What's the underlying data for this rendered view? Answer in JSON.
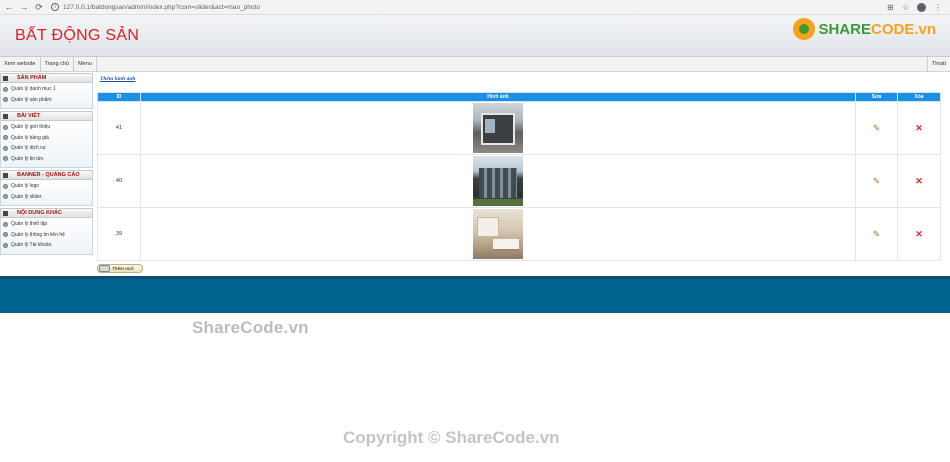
{
  "browser": {
    "url": "127.0.0.1/batdongsan/admin/index.php?com=slider&act=man_photo"
  },
  "header": {
    "site_title": "BẤT ĐỘNG SẢN",
    "logo_text_a": "SHARE",
    "logo_text_b": "CODE.vn"
  },
  "menu": {
    "items": [
      "Xem website",
      "Trang chủ",
      "Menu"
    ],
    "logout": "Thoát"
  },
  "sidebar": {
    "sections": [
      {
        "title": "SẢN PHẨM",
        "links": [
          "Quản lý danh mục 1",
          "Quản lý sản phẩm"
        ]
      },
      {
        "title": "BÀI VIẾT",
        "links": [
          "Quản lý giới thiệu",
          "Quản lý bảng giá",
          "Quản lý dịch vụ",
          "Quản lý tin tức"
        ]
      },
      {
        "title": "BANNER - QUẢNG CÁO",
        "links": [
          "Quản lý logo",
          "Quản lý slider"
        ]
      },
      {
        "title": "NỘI DUNG KHÁC",
        "links": [
          "Quản lý thiết lập",
          "Quản lý thông tin liên hệ",
          "Quản lý Tài khoản"
        ]
      }
    ]
  },
  "main": {
    "add_link": "Thêm hình ảnh",
    "columns": [
      "ID",
      "Hình ảnh",
      "Sửa",
      "Xóa"
    ],
    "rows": [
      {
        "id": "41"
      },
      {
        "id": "40"
      },
      {
        "id": "39"
      }
    ],
    "add_button": "Thêm mới"
  },
  "watermarks": {
    "top": "ShareCode.vn",
    "bottom": "Copyright © ShareCode.vn"
  },
  "colors": {
    "title_red": "#e02020",
    "table_header": "#1a8fe6",
    "footer": "#00628f"
  }
}
